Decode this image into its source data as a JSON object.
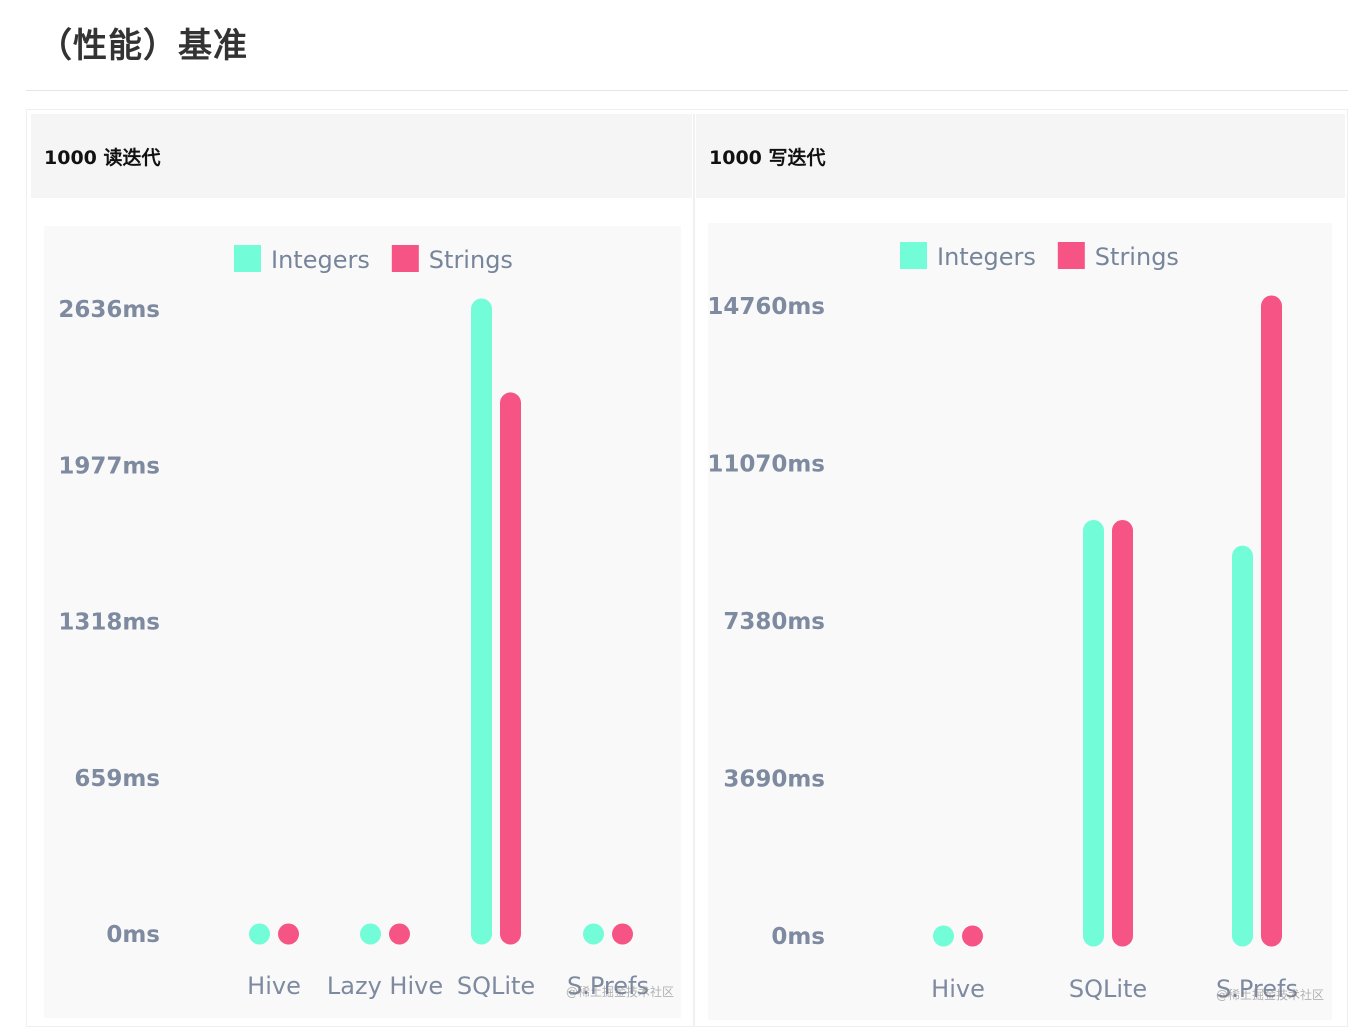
{
  "page": {
    "title": "（性能）基准"
  },
  "table": {
    "headers": [
      "1000 读迭代",
      "1000 写迭代"
    ]
  },
  "colors": {
    "integers": "#72fcd7",
    "strings": "#f55485"
  },
  "watermark": "@稀土掘金技术社区",
  "chart_data": [
    {
      "type": "bar",
      "title": "1000 读迭代",
      "legend": {
        "placement": "top-center",
        "entries": [
          "Integers",
          "Strings"
        ]
      },
      "categories": [
        "Hive",
        "Lazy Hive",
        "SQLite",
        "S.Prefs"
      ],
      "series": [
        {
          "name": "Integers",
          "values": [
            0,
            0,
            2636,
            0
          ]
        },
        {
          "name": "Strings",
          "values": [
            0,
            0,
            2240,
            0
          ]
        }
      ],
      "yticks": [
        "0ms",
        "659ms",
        "1318ms",
        "1977ms",
        "2636ms"
      ],
      "ylim": [
        0,
        2636
      ],
      "grid": false
    },
    {
      "type": "bar",
      "title": "1000 写迭代",
      "legend": {
        "placement": "top-center",
        "entries": [
          "Integers",
          "Strings"
        ]
      },
      "categories": [
        "Hive",
        "SQLite",
        "S.Prefs"
      ],
      "series": [
        {
          "name": "Integers",
          "values": [
            0,
            9500,
            8900
          ]
        },
        {
          "name": "Strings",
          "values": [
            0,
            9500,
            14760
          ]
        }
      ],
      "yticks": [
        "0ms",
        "3690ms",
        "7380ms",
        "11070ms",
        "14760ms"
      ],
      "ylim": [
        0,
        14760
      ],
      "grid": false
    }
  ]
}
